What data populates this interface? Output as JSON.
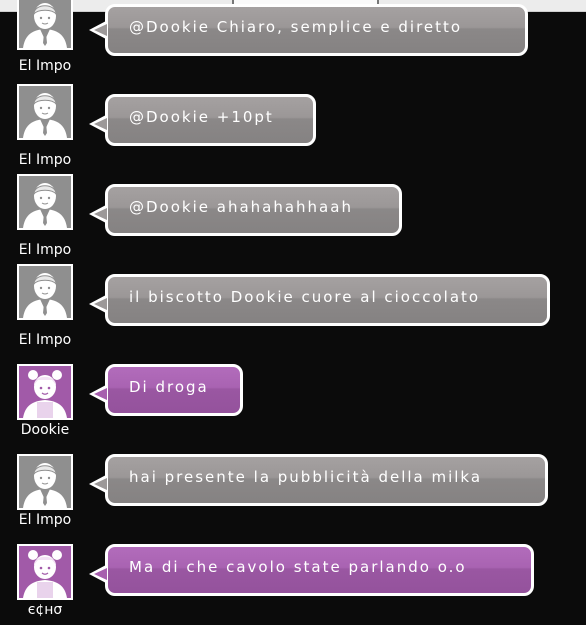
{
  "messages": [
    {
      "user": "El Impo",
      "avatar": "male-user-avatar",
      "theme": "gray",
      "text": "@Dookie Chiaro, semplice e diretto"
    },
    {
      "user": "El Impo",
      "avatar": "male-user-avatar",
      "theme": "gray",
      "text": "@Dookie +10pt"
    },
    {
      "user": "El Impo",
      "avatar": "male-user-avatar",
      "theme": "gray",
      "text": "@Dookie ahahahahhaah"
    },
    {
      "user": "El Impo",
      "avatar": "male-user-avatar",
      "theme": "gray",
      "text": "il biscotto Dookie cuore al cioccolato"
    },
    {
      "user": "Dookie",
      "avatar": "female-user-avatar",
      "theme": "purple",
      "text": "Di droga"
    },
    {
      "user": "El Impo",
      "avatar": "male-user-avatar",
      "theme": "gray",
      "text": "hai presente la pubblicità della milka"
    },
    {
      "user": "є¢нσ",
      "avatar": "female-user-avatar",
      "theme": "purple",
      "text": "Ma di che cavolo state parlando o.o"
    }
  ],
  "colors": {
    "background": "#0b0b0b",
    "bubble_gray": "#9b9797",
    "bubble_purple": "#a963b2",
    "avatar_gray": "#8f8f8f",
    "avatar_purple": "#a15aa8"
  }
}
